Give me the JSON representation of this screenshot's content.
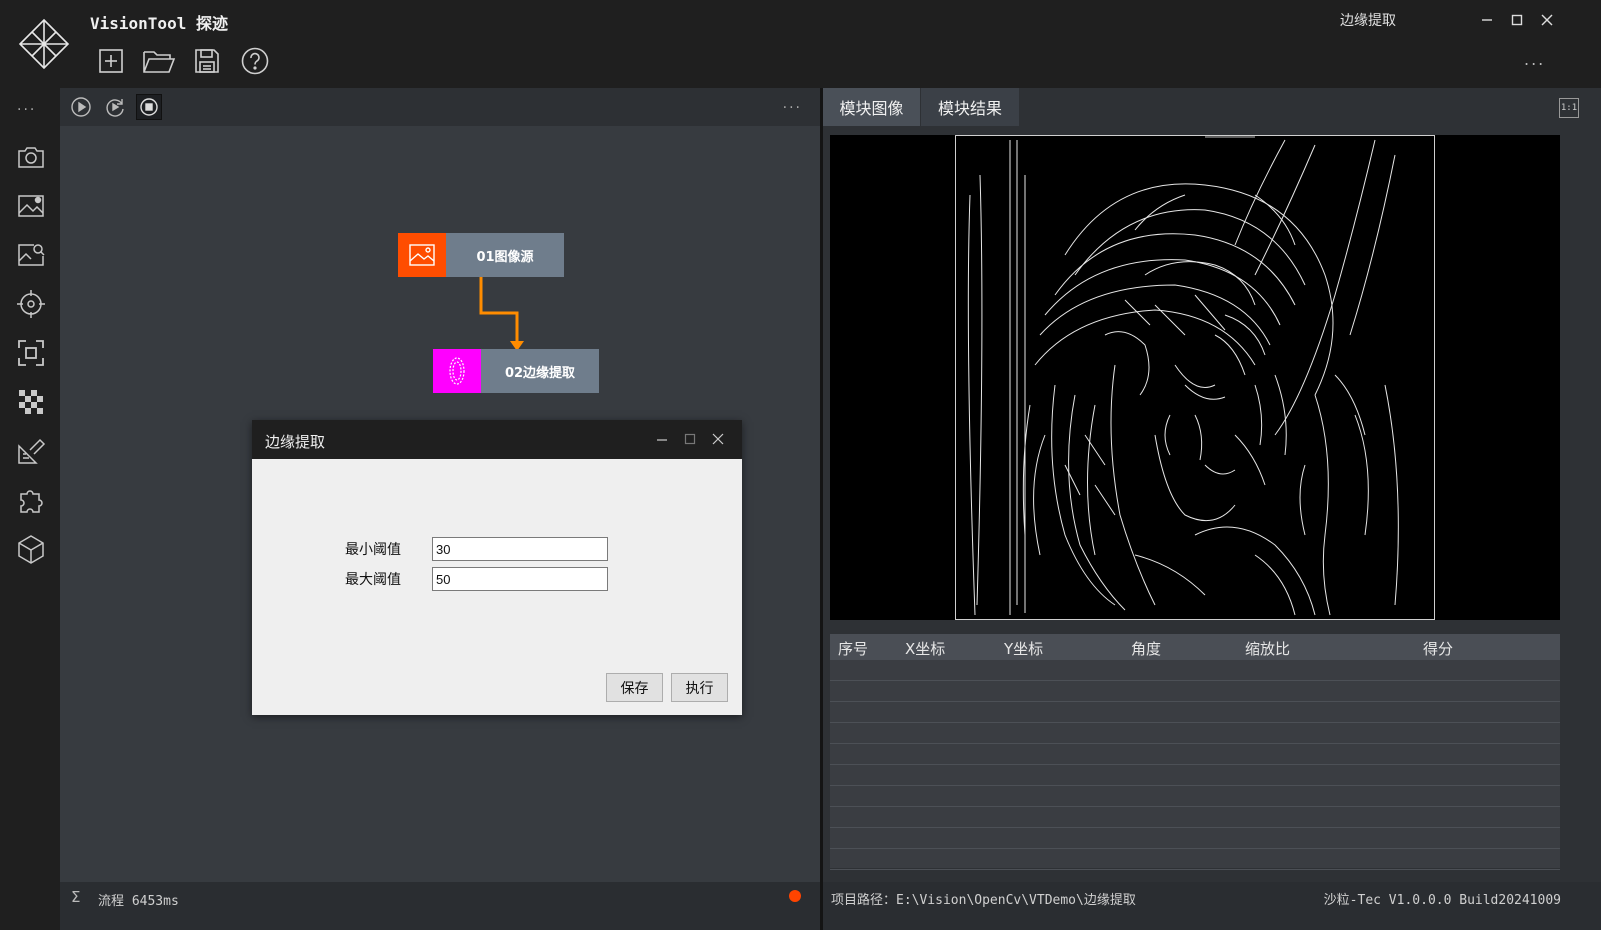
{
  "app": {
    "title": "VisionTool 探迹",
    "window_title": "边缘提取",
    "more": "..."
  },
  "toolbar": {
    "buttons": [
      {
        "icon": "new-file-icon"
      },
      {
        "icon": "open-folder-icon"
      },
      {
        "icon": "save-icon"
      },
      {
        "icon": "help-icon"
      }
    ]
  },
  "sidebar": {
    "more": "...",
    "icons": [
      "camera-icon",
      "image-settings-icon",
      "image-search-icon",
      "crosshair-icon",
      "focus-box-icon",
      "checker-icon",
      "measure-icon",
      "plugin-icon",
      "cube-icon"
    ]
  },
  "flow": {
    "more": "...",
    "controls": [
      "play-icon",
      "loop-play-icon",
      "stop-icon"
    ],
    "nodes": [
      {
        "label": "01图像源",
        "color": "#ff4d00",
        "icon": "image-icon"
      },
      {
        "label": "02边缘提取",
        "color": "#ff00ff",
        "icon": "edge-icon"
      }
    ],
    "connector_color": "#ff8c00"
  },
  "dialog": {
    "title": "边缘提取",
    "min_label": "最小阈值",
    "min_value": "30",
    "max_label": "最大阈值",
    "max_value": "50",
    "save_label": "保存",
    "run_label": "执行"
  },
  "tabs": {
    "image": "模块图像",
    "result": "模块结果",
    "ratio": "1:1"
  },
  "results": {
    "columns": [
      "序号",
      "X坐标",
      "Y坐标",
      "角度",
      "缩放比",
      "得分"
    ],
    "rows": []
  },
  "status": {
    "sigma": "Σ",
    "flow_time": "流程 6453ms",
    "indicator_color": "#ff4400",
    "project_path": "项目路径：E:\\Vision\\OpenCv\\VTDemo\\边缘提取",
    "version": "沙粒-Tec V1.0.0.0 Build20241009"
  }
}
